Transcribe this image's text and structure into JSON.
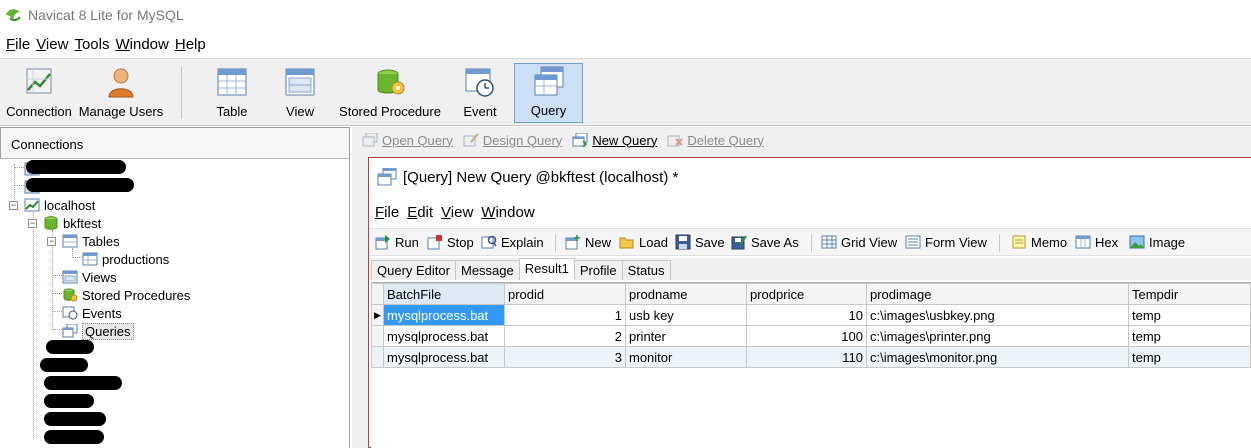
{
  "window": {
    "title": "Navicat 8 Lite for MySQL"
  },
  "menu": [
    {
      "u": "F",
      "rest": "ile"
    },
    {
      "u": "V",
      "rest": "iew"
    },
    {
      "u": "T",
      "rest": "ools"
    },
    {
      "u": "W",
      "rest": "indow"
    },
    {
      "u": "H",
      "rest": "elp"
    }
  ],
  "toolbar": {
    "connection": "Connection",
    "manage_users": "Manage Users",
    "table": "Table",
    "view": "View",
    "stored_procedure": "Stored Procedure",
    "event": "Event",
    "query": "Query"
  },
  "left": {
    "header": "Connections",
    "tree": {
      "localhost": "localhost",
      "bkftest": "bkftest",
      "tables": "Tables",
      "productions": "productions",
      "views": "Views",
      "stored_procedures": "Stored Procedures",
      "events": "Events",
      "queries": "Queries"
    }
  },
  "objbar": {
    "open_query": "Open Query",
    "design_query": "Design Query",
    "new_query": "New Query",
    "delete_query": "Delete Query"
  },
  "query_window": {
    "title": "[Query] New Query @bkftest (localhost) *",
    "menu": [
      {
        "u": "F",
        "rest": "ile"
      },
      {
        "u": "E",
        "rest": "dit"
      },
      {
        "u": "V",
        "rest": "iew"
      },
      {
        "u": "W",
        "rest": "indow"
      }
    ],
    "tools": {
      "run": "Run",
      "stop": "Stop",
      "explain": "Explain",
      "new": "New",
      "load": "Load",
      "save": "Save",
      "save_as": "Save As",
      "grid_view": "Grid View",
      "form_view": "Form View",
      "memo": "Memo",
      "hex": "Hex",
      "image": "Image"
    },
    "tabs": [
      "Query Editor",
      "Message",
      "Result1",
      "Profile",
      "Status"
    ],
    "active_tab": "Result1"
  },
  "grid": {
    "columns": [
      "BatchFile",
      "prodid",
      "prodname",
      "prodprice",
      "prodimage",
      "Tempdir"
    ],
    "rows": [
      [
        "mysqlprocess.bat",
        "1",
        "usb key",
        "10",
        "c:\\images\\usbkey.png",
        "temp"
      ],
      [
        "mysqlprocess.bat",
        "2",
        "printer",
        "100",
        "c:\\images\\printer.png",
        "temp"
      ],
      [
        "mysqlprocess.bat",
        "3",
        "monitor",
        "110",
        "c:\\images\\monitor.png",
        "temp"
      ]
    ]
  },
  "colors": {
    "selection": "#3399ff",
    "active_tool": "#cce0f5",
    "window_border": "#b04040"
  }
}
